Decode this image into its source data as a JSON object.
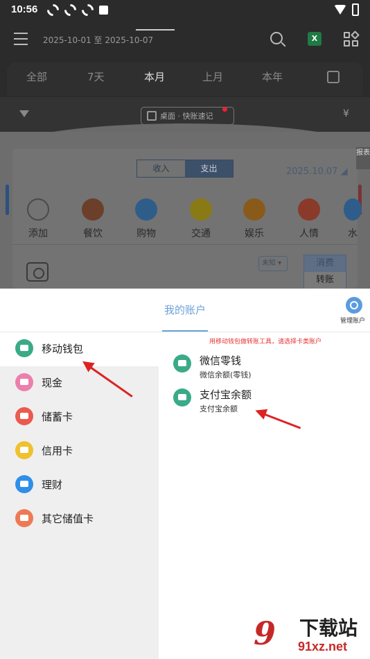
{
  "status_bar": {
    "time": "10:56",
    "battery_glyph": "⚡"
  },
  "header": {
    "date_range": "2025-10-01 至 2025-10-07",
    "excel_label": "X"
  },
  "period_tabs": [
    "全部",
    "7天",
    "本月",
    "上月",
    "本年"
  ],
  "active_tab": "本月",
  "filter_bar": {
    "quick_entry": "桌面 · 快账速记",
    "currency": "¥"
  },
  "background": {
    "report_tab": "报表",
    "type_toggle": {
      "income": "收入",
      "expense": "支出"
    },
    "date": "2025.10.07",
    "categories": [
      {
        "label": "添加",
        "color": "#6d6d6d"
      },
      {
        "label": "餐饮",
        "color": "#6b3f2a"
      },
      {
        "label": "购物",
        "color": "#2f5d8a"
      },
      {
        "label": "交通",
        "color": "#8a7a16"
      },
      {
        "label": "娱乐",
        "color": "#8a5a1a"
      },
      {
        "label": "人情",
        "color": "#8a3a2a"
      },
      {
        "label": "水",
        "color": "#2f5d8a"
      }
    ],
    "unknown_button": "未知",
    "spend_toggle": {
      "consume": "消费",
      "transfer": "转账"
    }
  },
  "sheet": {
    "title": "我的账户",
    "manage_label": "管理账户",
    "hint": "用移动钱包做转账工具，请选择卡类账户",
    "account_types": [
      {
        "label": "移动钱包",
        "color": "#3aaa87"
      },
      {
        "label": "现金",
        "color": "#ec7fae"
      },
      {
        "label": "储蓄卡",
        "color": "#ea5a4e"
      },
      {
        "label": "信用卡",
        "color": "#efc12e"
      },
      {
        "label": "理财",
        "color": "#2f8fe8"
      },
      {
        "label": "其它储值卡",
        "color": "#ee7a55"
      }
    ],
    "wallets": [
      {
        "name": "微信零钱",
        "desc": "微信余额(零钱)"
      },
      {
        "name": "支付宝余额",
        "desc": "支付宝余额"
      }
    ]
  },
  "watermark": {
    "logo": "9",
    "title": "下载站",
    "site": "91xz.net"
  }
}
